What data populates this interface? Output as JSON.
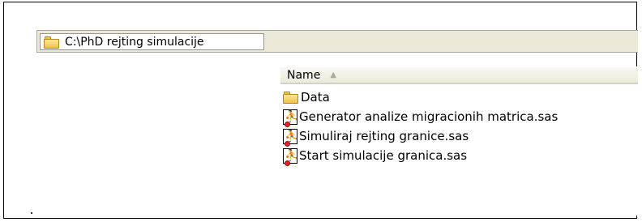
{
  "address_bar": {
    "path": "C:\\PhD rejting simulacije",
    "icon": "folder-icon"
  },
  "file_list": {
    "column_header": "Name",
    "sort_indicator": "▲",
    "items": [
      {
        "name": "Data",
        "icon": "folder-icon"
      },
      {
        "name": "Generator analize migracionih matrica.sas",
        "icon": "sas-program-icon"
      },
      {
        "name": "Simuliraj rejting granice.sas",
        "icon": "sas-program-icon"
      },
      {
        "name": "Start simulacije granica.sas",
        "icon": "sas-program-icon"
      }
    ]
  }
}
